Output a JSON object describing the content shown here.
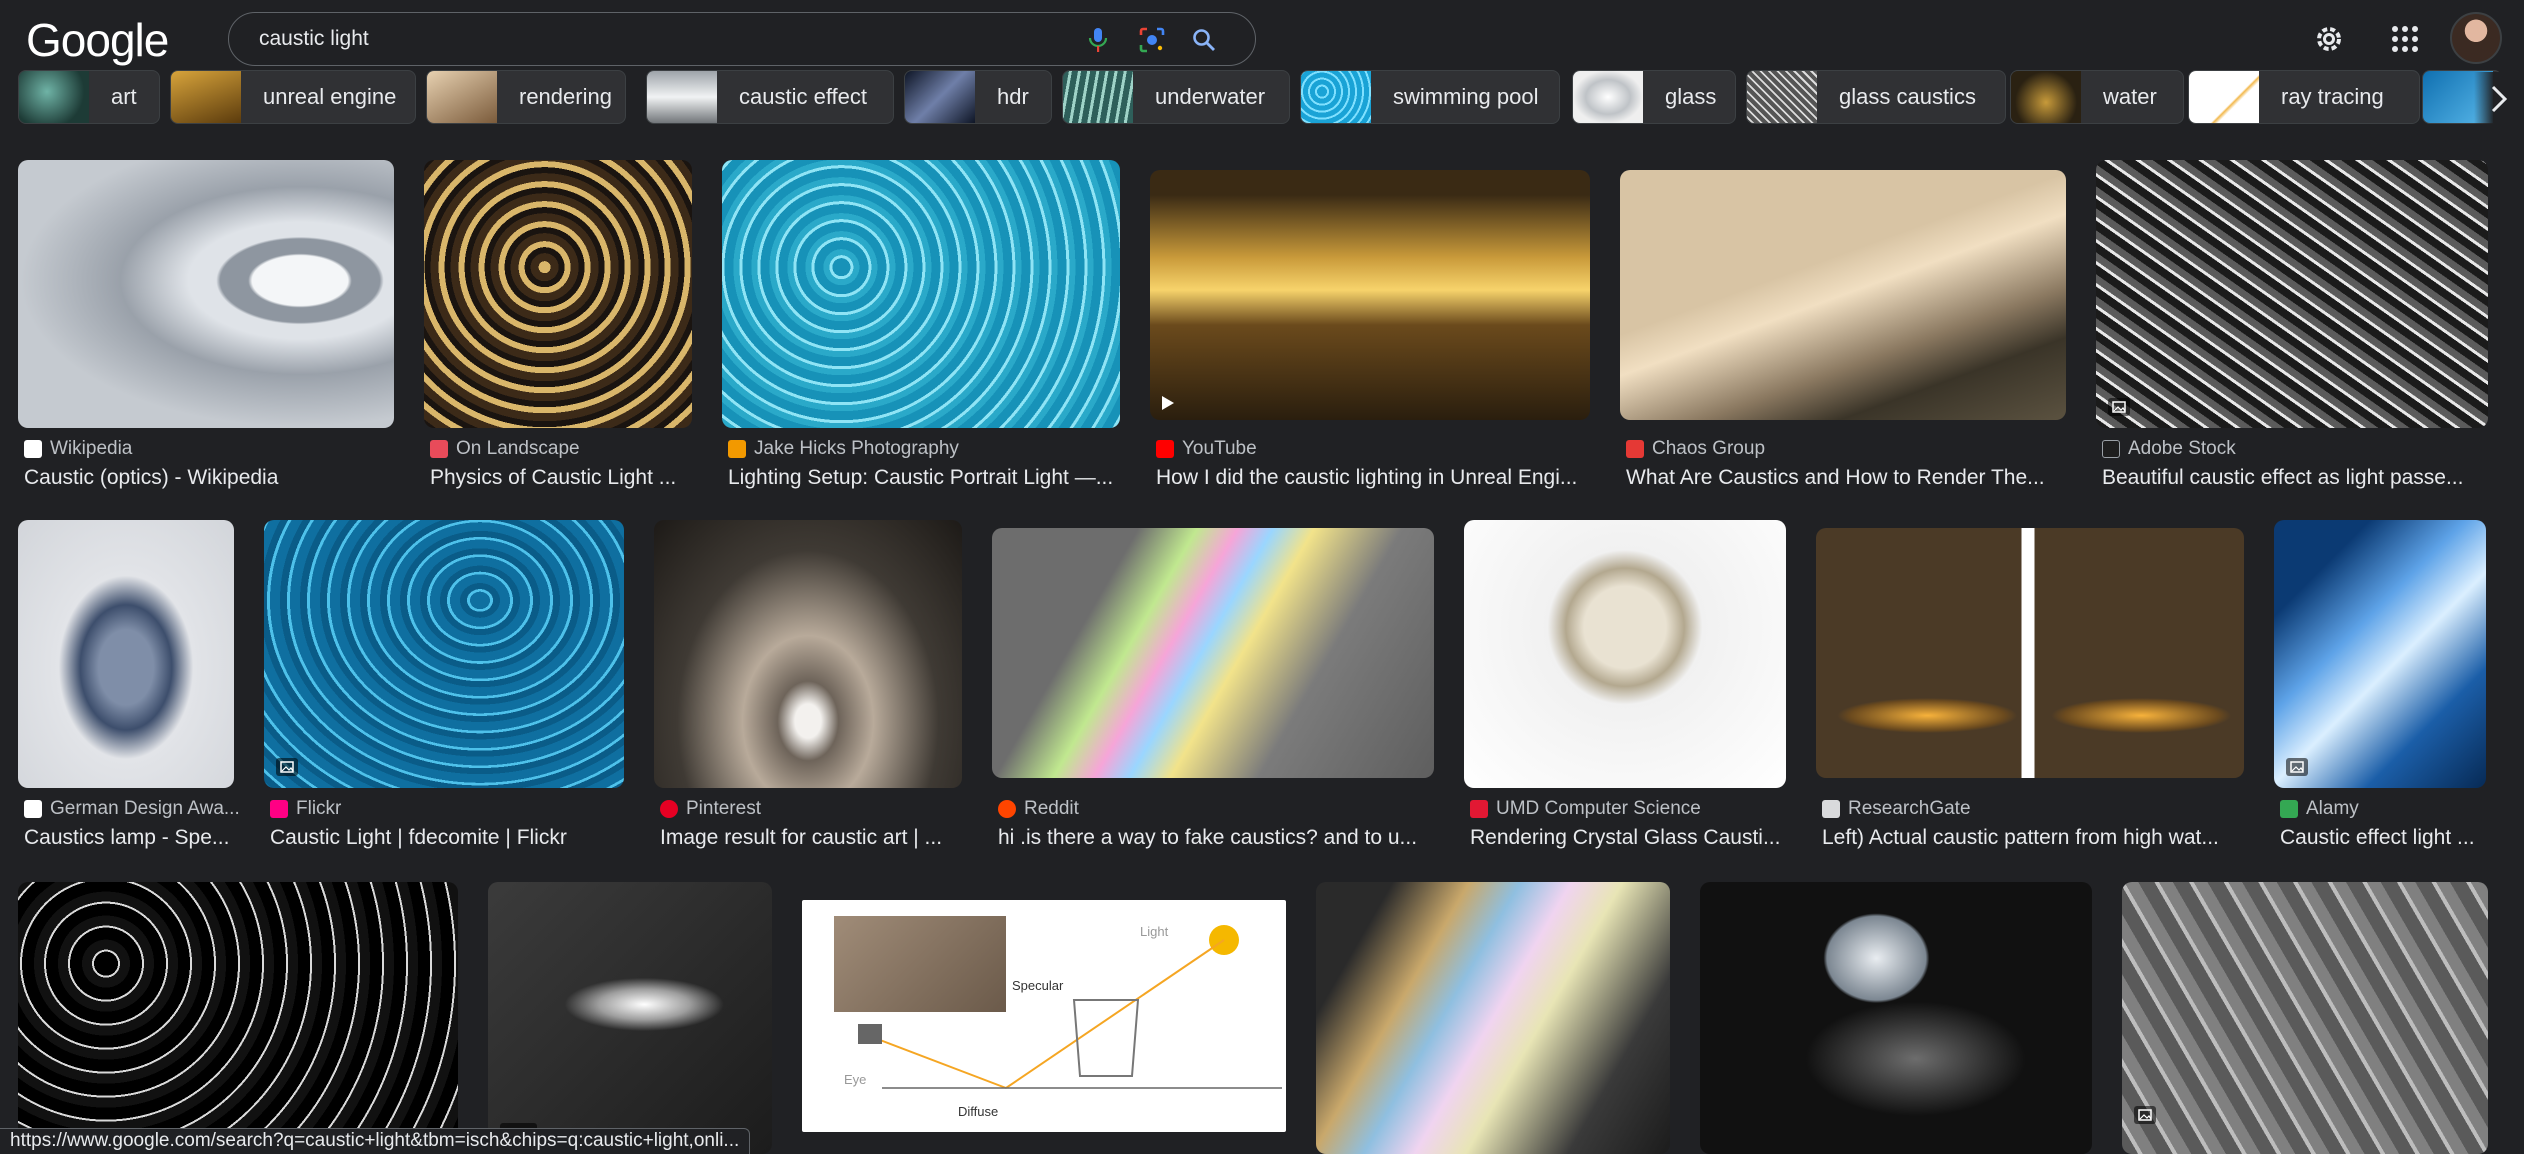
{
  "header": {
    "logo": "Google",
    "search_value": "caustic light",
    "search_icons": [
      "mic-icon",
      "lens-icon",
      "search-icon"
    ],
    "right_icons": [
      "gear-icon",
      "apps-grid-icon",
      "avatar"
    ]
  },
  "chips": [
    {
      "label": "art"
    },
    {
      "label": "unreal engine"
    },
    {
      "label": "rendering"
    },
    {
      "label": "caustic effect"
    },
    {
      "label": "hdr"
    },
    {
      "label": "underwater"
    },
    {
      "label": "swimming pool"
    },
    {
      "label": "glass"
    },
    {
      "label": "glass caustics"
    },
    {
      "label": "water"
    },
    {
      "label": "ray tracing"
    }
  ],
  "results": [
    {
      "source": "Wikipedia",
      "title": "Caustic (optics) - Wikipedia"
    },
    {
      "source": "On Landscape",
      "title": "Physics of Caustic Light ..."
    },
    {
      "source": "Jake Hicks Photography",
      "title": "Lighting Setup: Caustic Portrait Light —..."
    },
    {
      "source": "YouTube",
      "title": "How I did the caustic lighting in Unreal Engi..."
    },
    {
      "source": "Chaos Group",
      "title": "What Are Caustics and How to Render The..."
    },
    {
      "source": "Adobe Stock",
      "title": "Beautiful caustic effect as light passe..."
    },
    {
      "source": "German Design Awa...",
      "title": "Caustics lamp - Spe..."
    },
    {
      "source": "Flickr",
      "title": "Caustic Light | fdecomite | Flickr"
    },
    {
      "source": "Pinterest",
      "title": "Image result for caustic art | ..."
    },
    {
      "source": "Reddit",
      "title": "hi .is there a way to fake caustics? and to u..."
    },
    {
      "source": "UMD Computer Science",
      "title": "Rendering Crystal Glass Causti..."
    },
    {
      "source": "ResearchGate",
      "title": "Left) Actual caustic pattern from high wat..."
    },
    {
      "source": "Alamy",
      "title": "Caustic effect light ..."
    }
  ],
  "row3": {
    "gif_badge": "GIF",
    "diagram_labels": {
      "light": "Light",
      "specular": "Specular",
      "diffuse": "Diffuse",
      "eye": "Eye"
    }
  },
  "status_url": "https://www.google.com/search?q=caustic+light&tbm=isch&chips=q:caustic+light,onli...",
  "colors": {
    "background": "#202124",
    "chip_bg": "#303134",
    "text": "#e8eaed",
    "subtext": "#bdc1c6"
  }
}
